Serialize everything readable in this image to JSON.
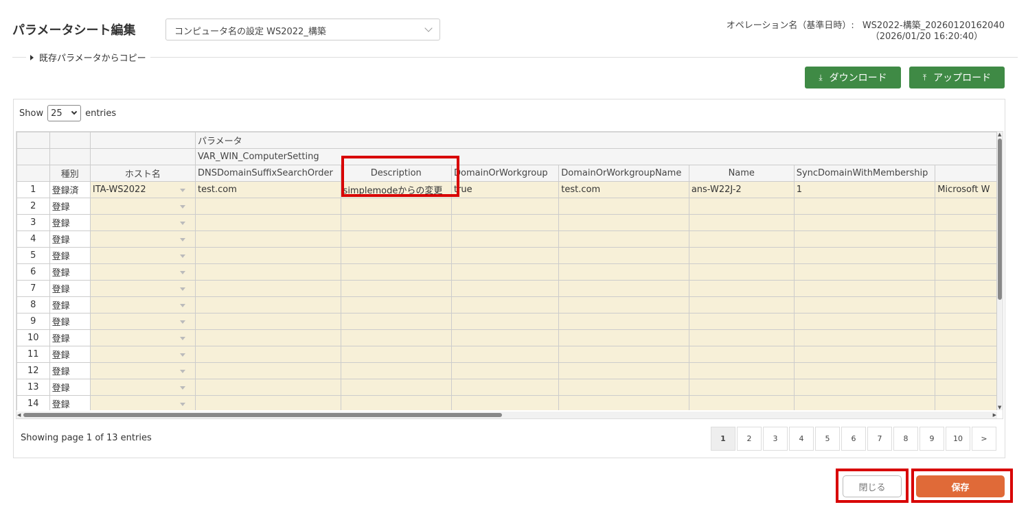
{
  "header": {
    "title": "パラメータシート編集",
    "menu_select_value": "コンピュータ名の設定 WS2022_構築",
    "operation_label": "オペレーション名（基準日時）:",
    "operation_name": "WS2022-構築_20260120162040",
    "operation_datetime": "（2026/01/20 16:20:40）"
  },
  "copy_toggle": {
    "label": "既存パラメータからコピー"
  },
  "toolbar": {
    "download_label": "ダウンロード",
    "upload_label": "アップロード",
    "download_icon": "download-icon",
    "upload_icon": "upload-icon"
  },
  "entries": {
    "show_label": "Show",
    "page_size": "25",
    "entries_label": "entries"
  },
  "grid": {
    "group_label": "パラメータ",
    "var_label": "VAR_WIN_ComputerSetting",
    "columns": {
      "kind": "種別",
      "host": "ホスト名",
      "dns": "DNSDomainSuffixSearchOrder",
      "description": "Description",
      "domain_or_workgroup": "DomainOrWorkgroup",
      "domain_or_workgroup_name": "DomainOrWorkgroupName",
      "name": "Name",
      "sync": "SyncDomainWithMembership"
    },
    "rows": [
      {
        "no": "1",
        "kind": "登録済",
        "host": "ITA-WS2022",
        "dns": "test.com",
        "description": "simplemodeからの変更",
        "dow": "true",
        "down": "test.com",
        "name": "ans-W22J-2",
        "sync": "1",
        "extra": "Microsoft W"
      },
      {
        "no": "2",
        "kind": "登録"
      },
      {
        "no": "3",
        "kind": "登録"
      },
      {
        "no": "4",
        "kind": "登録"
      },
      {
        "no": "5",
        "kind": "登録"
      },
      {
        "no": "6",
        "kind": "登録"
      },
      {
        "no": "7",
        "kind": "登録"
      },
      {
        "no": "8",
        "kind": "登録"
      },
      {
        "no": "9",
        "kind": "登録"
      },
      {
        "no": "10",
        "kind": "登録"
      },
      {
        "no": "11",
        "kind": "登録"
      },
      {
        "no": "12",
        "kind": "登録"
      },
      {
        "no": "13",
        "kind": "登録"
      },
      {
        "no": "14",
        "kind": "登録"
      }
    ]
  },
  "footer": {
    "showing_text": "Showing page 1 of 13 entries",
    "pages": [
      "1",
      "2",
      "3",
      "4",
      "5",
      "6",
      "7",
      "8",
      "9",
      "10"
    ],
    "next_label": ">",
    "close_label": "閉じる",
    "save_label": "保存"
  },
  "colors": {
    "primary_green": "#3f8a45",
    "save_orange": "#e06a38",
    "highlight_red": "#d80000",
    "cell_bg": "#f7f0d8"
  }
}
